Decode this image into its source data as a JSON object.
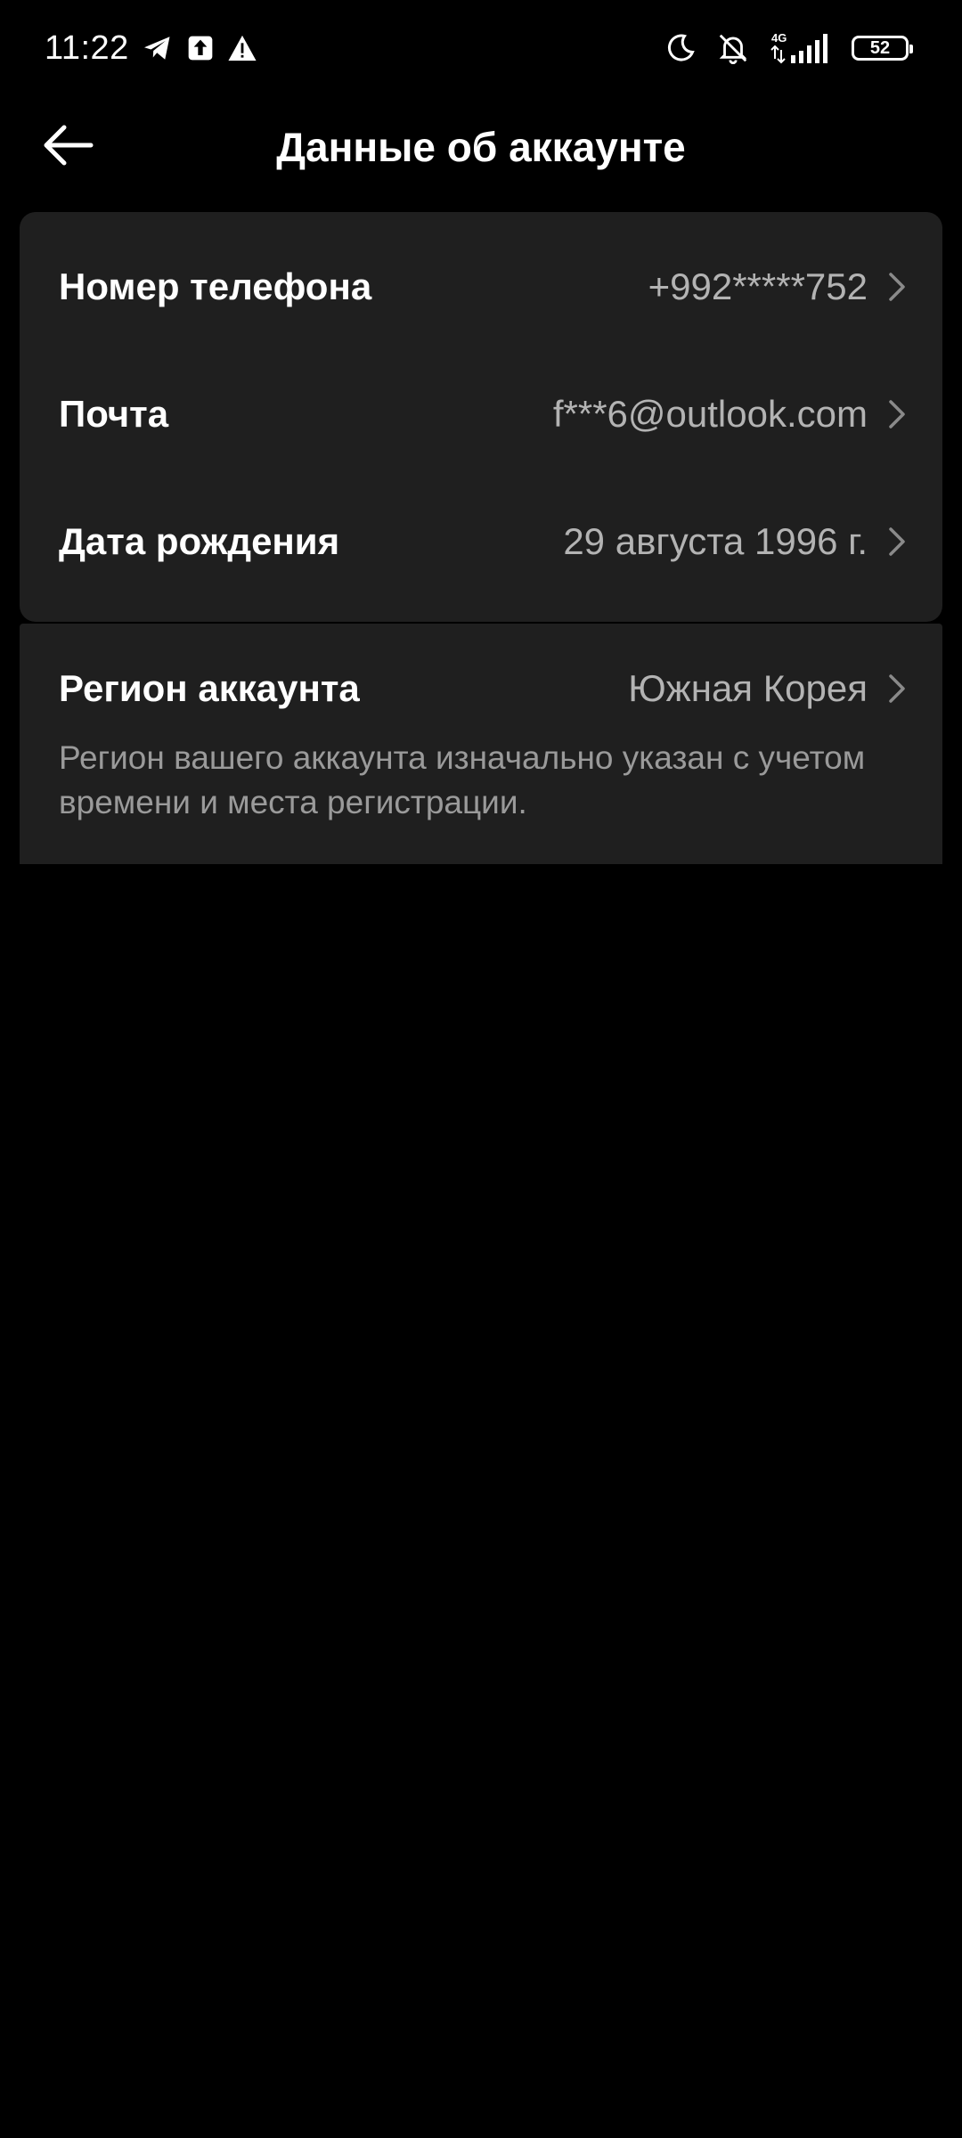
{
  "status_bar": {
    "time": "11:22",
    "network_type": "4G",
    "battery_level": "52"
  },
  "header": {
    "title": "Данные об аккаунте"
  },
  "account_info": {
    "rows": [
      {
        "label": "Номер телефона",
        "value": "+992*****752"
      },
      {
        "label": "Почта",
        "value": "f***6@outlook.com"
      },
      {
        "label": "Дата рождения",
        "value": "29 августа 1996 г."
      }
    ]
  },
  "region": {
    "label": "Регион аккаунта",
    "value": "Южная Корея",
    "note": "Регион вашего аккаунта изначально указан с учетом времени и места регистрации."
  },
  "icons": {
    "back": "arrow-left-icon",
    "chevron": "chevron-right-icon",
    "telegram": "telegram-icon",
    "upload": "upload-icon",
    "warning": "warning-icon",
    "moon": "moon-icon",
    "bell_off": "bell-off-icon",
    "signal": "signal-icon"
  },
  "colors": {
    "background": "#000000",
    "card": "#1f1f1f",
    "label": "#ffffff",
    "value": "#b3b3b3",
    "note": "#9a9a9a"
  }
}
